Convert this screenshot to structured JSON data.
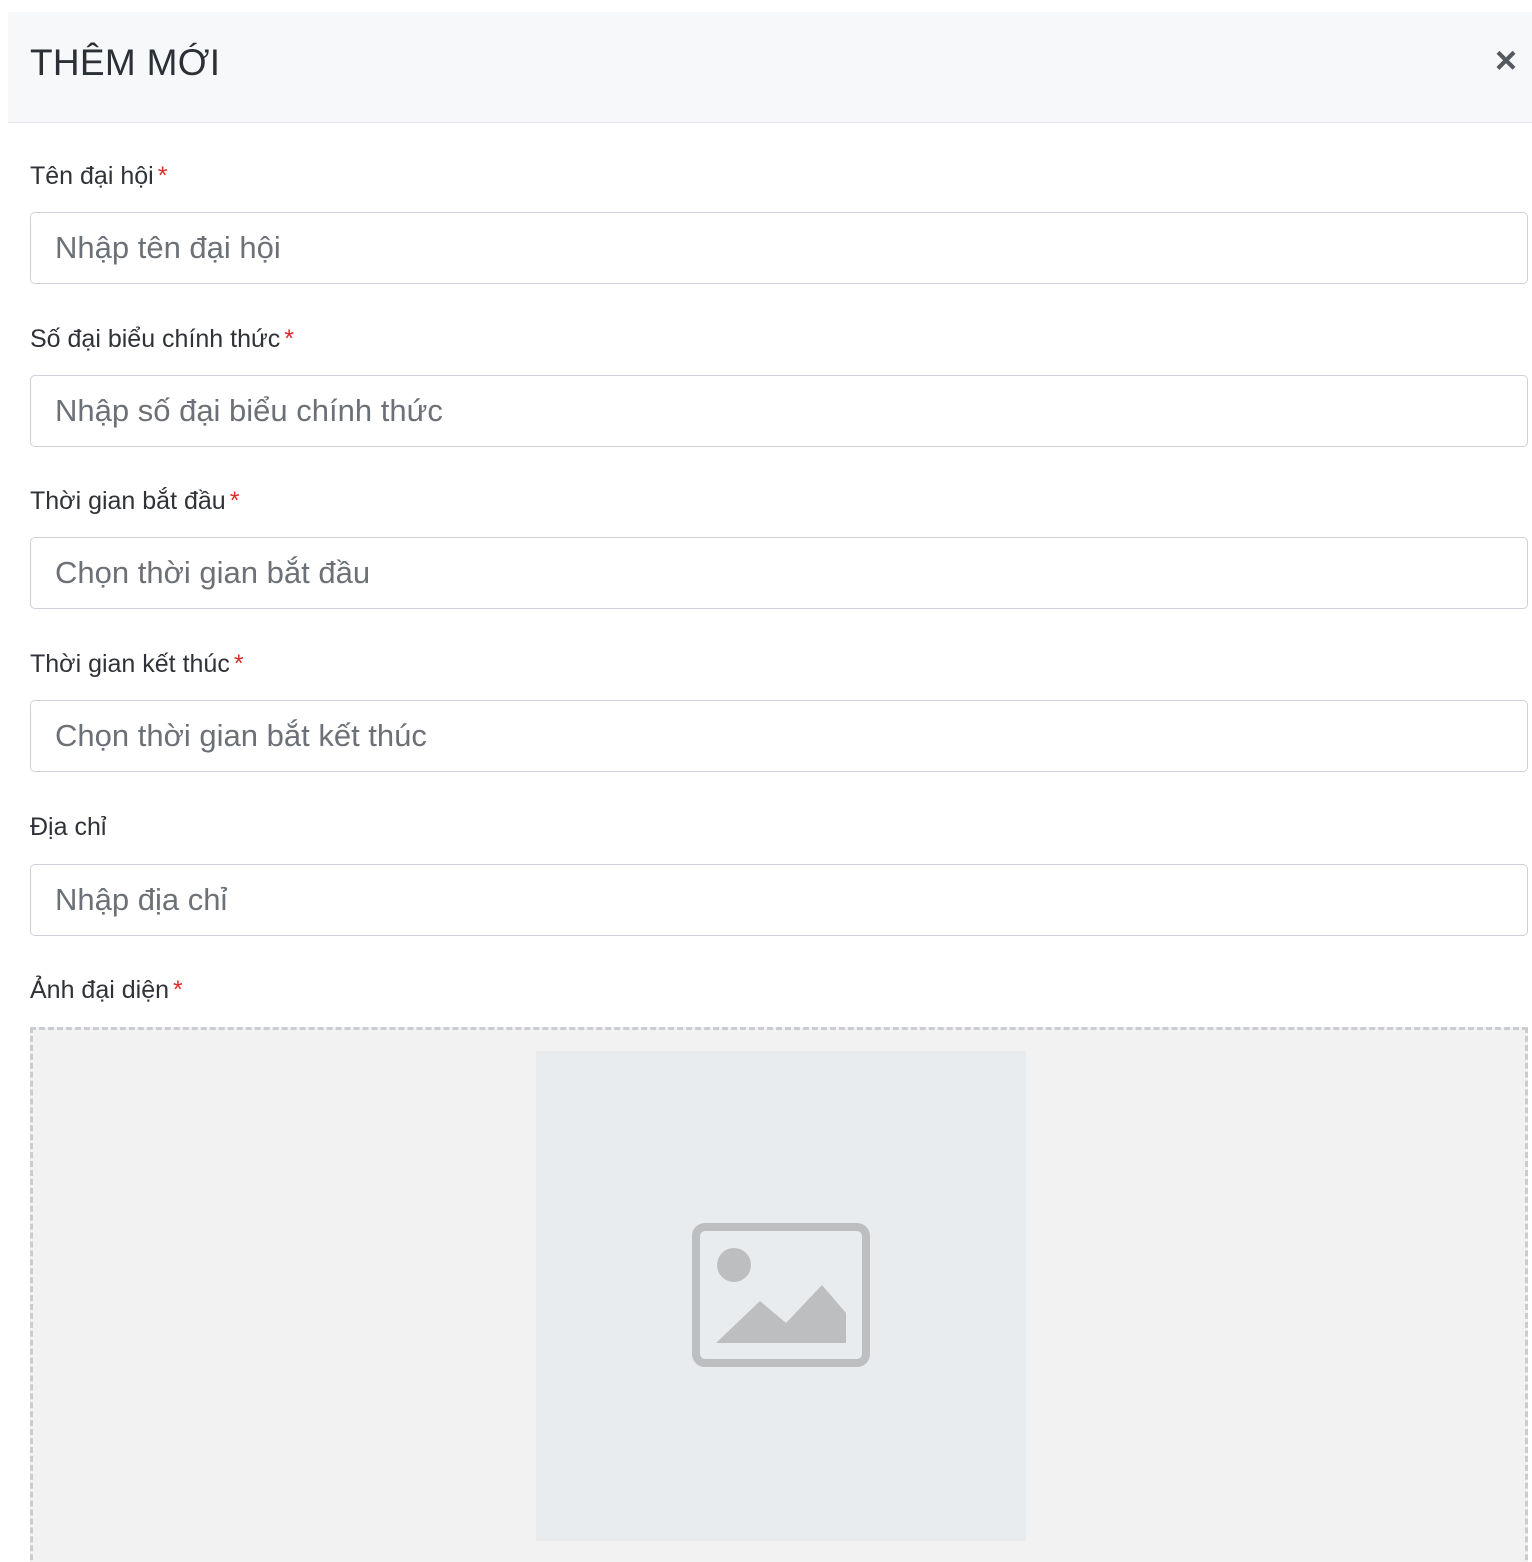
{
  "modal": {
    "title": "THÊM MỚI",
    "close_icon": "close-icon",
    "close_symbol": "×"
  },
  "form": {
    "required_mark": "*",
    "fields": [
      {
        "label": "Tên đại hội",
        "required": true,
        "placeholder": "Nhập tên đại hội",
        "value": ""
      },
      {
        "label": "Số đại biểu chính thức",
        "required": true,
        "placeholder": "Nhập số đại biểu chính thức",
        "value": ""
      },
      {
        "label": "Thời gian bắt đầu",
        "required": true,
        "placeholder": "Chọn thời gian bắt đầu",
        "value": ""
      },
      {
        "label": "Thời gian kết thúc",
        "required": true,
        "placeholder": "Chọn thời gian bắt kết thúc",
        "value": ""
      },
      {
        "label": "Địa chỉ",
        "required": false,
        "placeholder": "Nhập địa chỉ",
        "value": ""
      }
    ],
    "image_upload": {
      "label": "Ảnh đại diện",
      "required": true,
      "icon": "image-placeholder-icon"
    }
  },
  "colors": {
    "required": "#e02b2b",
    "header_bg": "#f7f8fa",
    "input_border": "#ced2d8",
    "upload_bg": "#f2f2f2",
    "preview_bg": "#e9ecef",
    "icon_gray": "#bcbec0"
  }
}
